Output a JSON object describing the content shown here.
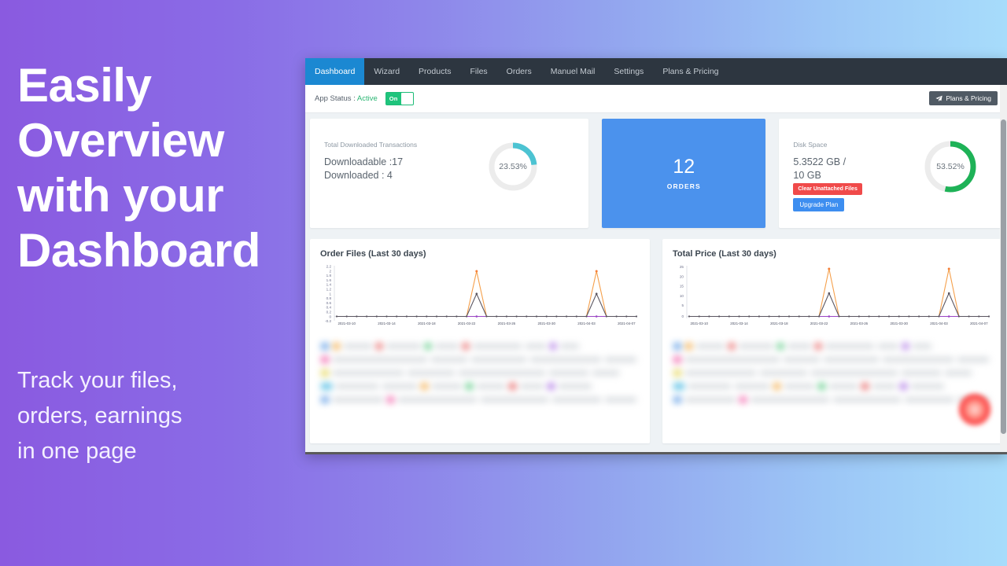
{
  "promo": {
    "headline": "Easily\nOverview\nwith your\nDashboard",
    "subtext": "Track your files,\norders, earnings\nin one page"
  },
  "colors": {
    "bg_gradient_start": "#8a5ae0",
    "bg_gradient_end": "#a7dcfb",
    "navbar": "#2d3640",
    "nav_active": "#1b88d2",
    "orders_card": "#4b92ed",
    "donut_teal": "#4cc3d2",
    "donut_green": "#1eb257",
    "toggle_green": "#1fc47c",
    "danger_red": "#f04a4a",
    "primary_blue": "#3d8ef0",
    "series_orange": "#f5a councils"
  },
  "navbar": {
    "items": [
      {
        "label": "Dashboard",
        "active": true
      },
      {
        "label": "Wizard",
        "active": false
      },
      {
        "label": "Products",
        "active": false
      },
      {
        "label": "Files",
        "active": false
      },
      {
        "label": "Orders",
        "active": false
      },
      {
        "label": "Manuel Mail",
        "active": false
      },
      {
        "label": "Settings",
        "active": false
      },
      {
        "label": "Plans & Pricing",
        "active": false
      }
    ]
  },
  "statusbar": {
    "label": "App Status : ",
    "status_value": "Active",
    "toggle_label": "On",
    "plans_button": "Plans & Pricing"
  },
  "cards": {
    "transactions": {
      "title": "Total Downloaded Transactions",
      "line1": "Downloadable :17",
      "line2": "Downloaded : 4",
      "percent_label": "23.53%",
      "percent_value": 23.53
    },
    "orders": {
      "value": "12",
      "label": "ORDERS"
    },
    "disk": {
      "title": "Disk Space",
      "line1": "5.3522 GB /",
      "line2": "10 GB",
      "clear_button": "Clear Unattached Files",
      "upgrade_button": "Upgrade Plan",
      "percent_label": "53.52%",
      "percent_value": 53.52
    }
  },
  "chart_data": [
    {
      "type": "line",
      "title": "Order Files (Last 30 days)",
      "xlabel": "",
      "ylabel": "",
      "grid": false,
      "legend": "none",
      "ylim": [
        -0.2,
        2.2
      ],
      "yticks": [
        "-0.2",
        "0",
        "0.2",
        "0.4",
        "0.6",
        "0.8",
        "1",
        "1.2",
        "1.4",
        "1.6",
        "1.8",
        "2",
        "2.2"
      ],
      "x": [
        "2021-03-09",
        "2021-03-10",
        "2021-03-11",
        "2021-03-12",
        "2021-03-13",
        "2021-03-14",
        "2021-03-15",
        "2021-03-16",
        "2021-03-17",
        "2021-03-18",
        "2021-03-19",
        "2021-03-20",
        "2021-03-21",
        "2021-03-22",
        "2021-03-23",
        "2021-03-24",
        "2021-03-25",
        "2021-03-26",
        "2021-03-27",
        "2021-03-28",
        "2021-03-29",
        "2021-03-30",
        "2021-03-31",
        "2021-04-01",
        "2021-04-02",
        "2021-04-03",
        "2021-04-04",
        "2021-04-05",
        "2021-04-06",
        "2021-04-07",
        "2021-04-08"
      ],
      "xticklabels": [
        "2021-03-10",
        "2021-03-14",
        "2021-03-18",
        "2021-03-22",
        "2021-03-26",
        "2021-03-30",
        "2021-04-03",
        "2021-04-07"
      ],
      "series": [
        {
          "name": "orange",
          "color": "#f5a04c",
          "values": [
            0,
            0,
            0,
            0,
            0,
            0,
            0,
            0,
            0,
            0,
            0,
            0,
            0,
            0,
            0,
            2,
            0,
            0,
            0,
            0,
            0,
            0,
            0,
            0,
            0,
            0,
            0,
            2,
            0,
            0,
            0
          ]
        },
        {
          "name": "dark",
          "color": "#5a5560",
          "values": [
            0,
            0,
            0,
            0,
            0,
            0,
            0,
            0,
            0,
            0,
            0,
            0,
            0,
            0,
            0,
            1,
            0,
            0,
            0,
            0,
            0,
            0,
            0,
            0,
            0,
            0,
            0,
            1,
            0,
            0,
            0
          ]
        },
        {
          "name": "purple",
          "color": "#9b46c4",
          "values": [
            0,
            0,
            0,
            0,
            0,
            0,
            0,
            0,
            0,
            0,
            0,
            0,
            0,
            0,
            0,
            0,
            0,
            0,
            0,
            0,
            0,
            0,
            0,
            0,
            0,
            0,
            0,
            0,
            0,
            0,
            0
          ]
        }
      ]
    },
    {
      "type": "line",
      "title": "Total Price (Last 30 days)",
      "xlabel": "",
      "ylabel": "",
      "grid": false,
      "legend": "none",
      "ylim": [
        0,
        25
      ],
      "yticks": [
        "0",
        "5",
        "10",
        "15",
        "20",
        "25"
      ],
      "x": [
        "2021-03-09",
        "2021-03-10",
        "2021-03-11",
        "2021-03-12",
        "2021-03-13",
        "2021-03-14",
        "2021-03-15",
        "2021-03-16",
        "2021-03-17",
        "2021-03-18",
        "2021-03-19",
        "2021-03-20",
        "2021-03-21",
        "2021-03-22",
        "2021-03-23",
        "2021-03-24",
        "2021-03-25",
        "2021-03-26",
        "2021-03-27",
        "2021-03-28",
        "2021-03-29",
        "2021-03-30",
        "2021-03-31",
        "2021-04-01",
        "2021-04-02",
        "2021-04-03",
        "2021-04-04",
        "2021-04-05",
        "2021-04-06",
        "2021-04-07",
        "2021-04-08"
      ],
      "xticklabels": [
        "2021-03-10",
        "2021-03-14",
        "2021-03-18",
        "2021-03-22",
        "2021-03-26",
        "2021-03-30",
        "2021-04-03",
        "2021-04-07"
      ],
      "series": [
        {
          "name": "orange",
          "color": "#f5a04c",
          "values": [
            0,
            0,
            0,
            0,
            0,
            0,
            0,
            0,
            0,
            0,
            0,
            0,
            0,
            0,
            0,
            24.5,
            0,
            0,
            0,
            0,
            0,
            0,
            0,
            0,
            0,
            0,
            0,
            24.5,
            0,
            0,
            0
          ]
        },
        {
          "name": "dark",
          "color": "#5a5560",
          "values": [
            0,
            0,
            0,
            0,
            0,
            0,
            0,
            0,
            0,
            0,
            0,
            0,
            0,
            0,
            0,
            12,
            0,
            0,
            0,
            0,
            0,
            0,
            0,
            0,
            0,
            0,
            0,
            12,
            0,
            0,
            0
          ]
        },
        {
          "name": "purple",
          "color": "#9b46c4",
          "values": [
            0,
            0,
            0,
            0,
            0,
            0,
            0,
            0,
            0,
            0,
            0,
            0,
            0,
            0,
            0,
            0,
            0,
            0,
            0,
            0,
            0,
            0,
            0,
            0,
            0,
            0,
            0,
            0,
            0,
            0,
            0
          ]
        }
      ]
    }
  ]
}
